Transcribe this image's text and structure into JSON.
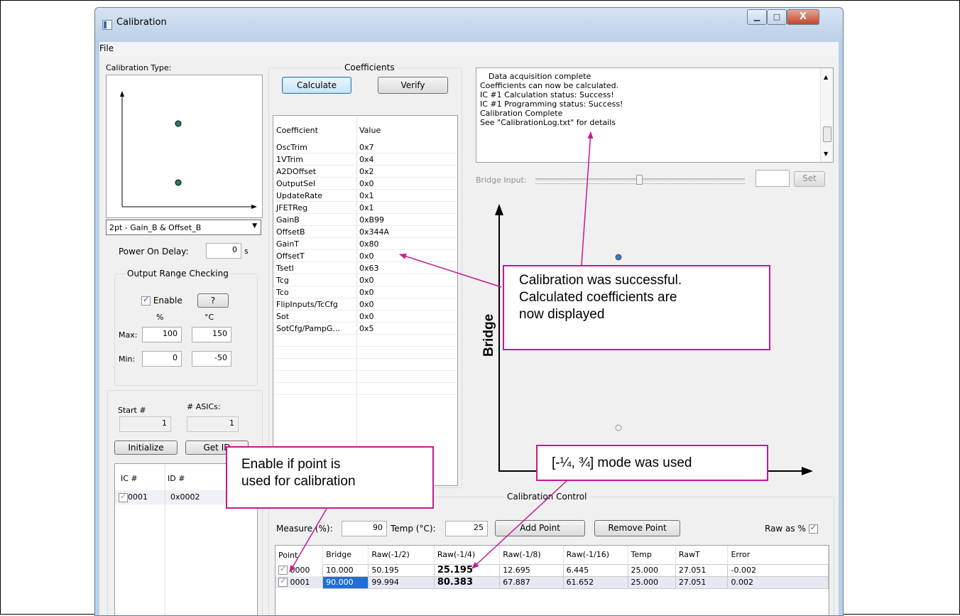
{
  "window": {
    "title": "Calibration",
    "minimize_label": "▁",
    "maximize_label": "□",
    "close_label": "X"
  },
  "menu": {
    "file": "File"
  },
  "left": {
    "calibration_type_label": "Calibration Type:",
    "calibration_type_value": "2pt - Gain_B & Offset_B",
    "power_on_delay_label": "Power On Delay:",
    "power_on_delay_value": "0",
    "power_on_delay_unit": "s",
    "range_group_title": "Output Range Checking",
    "enable_label": "Enable",
    "help_label": "?",
    "col_percent": "%",
    "col_celsius": "°C",
    "max_label": "Max:",
    "max_percent": "100",
    "max_celsius": "150",
    "min_label": "Min:",
    "min_percent": "0",
    "min_celsius": "-50",
    "start_label": "Start #",
    "asics_label": "# ASICs:",
    "start_value": "1",
    "asics_value": "1",
    "initialize_label": "Initialize",
    "getid_label": "Get ID",
    "ic_headers": [
      "IC #",
      "ID #"
    ],
    "ic_rows": [
      {
        "ic": "0001",
        "id": "0x0002"
      }
    ]
  },
  "coefficients": {
    "group_title": "Coefficients",
    "calculate_label": "Calculate",
    "verify_label": "Verify",
    "headers": [
      "Coefficient",
      "Value"
    ],
    "rows": [
      {
        "name": "OscTrim",
        "value": "0x7"
      },
      {
        "name": "1VTrim",
        "value": "0x4"
      },
      {
        "name": "A2DOffset",
        "value": "0x2"
      },
      {
        "name": "OutputSel",
        "value": "0x0"
      },
      {
        "name": "UpdateRate",
        "value": "0x1"
      },
      {
        "name": "JFETReg",
        "value": "0x1"
      },
      {
        "name": "GainB",
        "value": "0xB99"
      },
      {
        "name": "OffsetB",
        "value": "0x344A"
      },
      {
        "name": "GainT",
        "value": "0x80"
      },
      {
        "name": "OffsetT",
        "value": "0x0"
      },
      {
        "name": "Tsetl",
        "value": "0x63"
      },
      {
        "name": "Tcg",
        "value": "0x0"
      },
      {
        "name": "Tco",
        "value": "0x0"
      },
      {
        "name": "FlipInputs/TcCfg",
        "value": "0x0"
      },
      {
        "name": "Sot",
        "value": "0x0"
      },
      {
        "name": "SotCfg/PampG...",
        "value": "0x5"
      }
    ]
  },
  "log": {
    "lines": [
      "Data acquisition complete",
      "Coefficients can now be calculated.",
      "IC #1 Calculation status: Success!",
      "IC #1 Programming status: Success!",
      "Calibration Complete",
      "See \"CalibrationLog.txt\" for details"
    ]
  },
  "bridge": {
    "input_label": "Bridge Input:",
    "set_label": "Set",
    "axis_label": "Bridge"
  },
  "control": {
    "group_title": "Calibration Control",
    "measure_label": "Measure (%):",
    "measure_value": "90",
    "temp_label": "Temp (°C):",
    "temp_value": "25",
    "add_point_label": "Add Point",
    "remove_point_label": "Remove Point",
    "raw_as_pct_label": "Raw as %",
    "headers": [
      "Point",
      "Bridge",
      "Raw(-1/2)",
      "Raw(-1/4)",
      "Raw(-1/8)",
      "Raw(-1/16)",
      "Temp",
      "RawT",
      "Error"
    ],
    "rows": [
      {
        "point": "0000",
        "bridge": "10.000",
        "raw2": "50.195",
        "raw4": "25.195",
        "raw8": "12.695",
        "raw16": "6.445",
        "temp": "25.000",
        "rawt": "27.051",
        "error": "-0.002"
      },
      {
        "point": "0001",
        "bridge": "90.000",
        "raw2": "99.994",
        "raw4": "80.383",
        "raw8": "67.887",
        "raw16": "61.652",
        "temp": "25.000",
        "rawt": "27.051",
        "error": "0.002"
      }
    ]
  },
  "callouts": {
    "success": [
      "Calibration was successful.",
      "Calculated coefficients are",
      "now displayed"
    ],
    "enable": [
      "Enable if point is",
      "used for calibration"
    ],
    "mode": "[-¼, ¾] mode was used"
  },
  "colors": {
    "callout_border": "#c41a92",
    "plot_point": "#2a7a6e",
    "selected_cell": "#1e6fd6"
  }
}
